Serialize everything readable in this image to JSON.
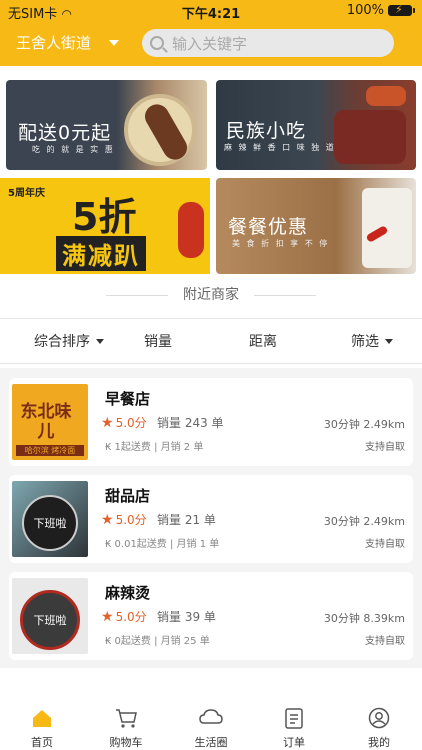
{
  "status_bar": {
    "carrier": "无SIM卡",
    "time": "下午4:21",
    "battery": "100%"
  },
  "header": {
    "location": "王舍人街道",
    "search_placeholder": "输入关键字"
  },
  "banners": [
    {
      "title": "配送0元起",
      "subtitle": "吃 的 就 是 实 惠"
    },
    {
      "title": "民族小吃",
      "subtitle": "麻 辣 鲜 香 口 味 独 道"
    },
    {
      "title": "5折",
      "subtitle": "满减趴",
      "tag": "5周年庆"
    },
    {
      "title": "餐餐优惠",
      "subtitle": "美 食 折 扣 享 不 停"
    }
  ],
  "nearby_title": "附近商家",
  "filters": {
    "sort": "综合排序",
    "sales": "销量",
    "distance": "距离",
    "filter": "筛选"
  },
  "shops": [
    {
      "name": "早餐店",
      "score": "5.0分",
      "sales": "销量 243 单",
      "meta": "₭ 1起送费 | 月销 2 单",
      "time": "30分钟  2.49km",
      "pickup": "支持自取",
      "thumb_text": "东北味儿",
      "thumb_sub": "哈尔滨 烤冷面"
    },
    {
      "name": "甜品店",
      "score": "5.0分",
      "sales": "销量 21 单",
      "meta": "₭ 0.01起送费 | 月销 1 单",
      "time": "30分钟  2.49km",
      "pickup": "支持自取",
      "thumb_text": "下班啦"
    },
    {
      "name": "麻辣烫",
      "score": "5.0分",
      "sales": "销量 39 单",
      "meta": "₭ 0起送费 | 月销 25 单",
      "time": "30分钟  8.39km",
      "pickup": "支持自取",
      "thumb_text": "下班啦"
    }
  ],
  "tabbar": [
    {
      "label": "首页",
      "icon": "home-icon"
    },
    {
      "label": "购物车",
      "icon": "cart-icon"
    },
    {
      "label": "生活圈",
      "icon": "cloud-icon"
    },
    {
      "label": "订单",
      "icon": "order-icon"
    },
    {
      "label": "我的",
      "icon": "user-icon"
    }
  ],
  "colors": {
    "accent": "#f7b916",
    "price": "#e2612a"
  }
}
